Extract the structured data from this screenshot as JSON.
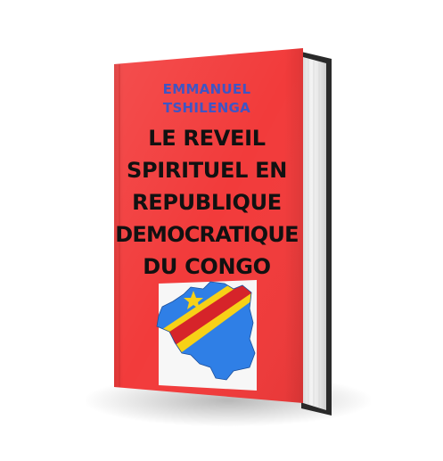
{
  "book": {
    "author_line_1": "EMMANUEL",
    "author_line_2": "TSHILENGA",
    "title_lines": [
      "LE REVEIL",
      "SPIRITUEL EN",
      "REPUBLIQUE",
      "DEMOCRATIQUE",
      "DU CONGO"
    ],
    "cover_color": "#f23b3b",
    "author_color": "#3f55c4",
    "map_flag": {
      "field_color": "#2f7fe6",
      "stripe_color": "#d6242a",
      "border_color": "#f7d117",
      "star_color": "#f7d117"
    }
  }
}
